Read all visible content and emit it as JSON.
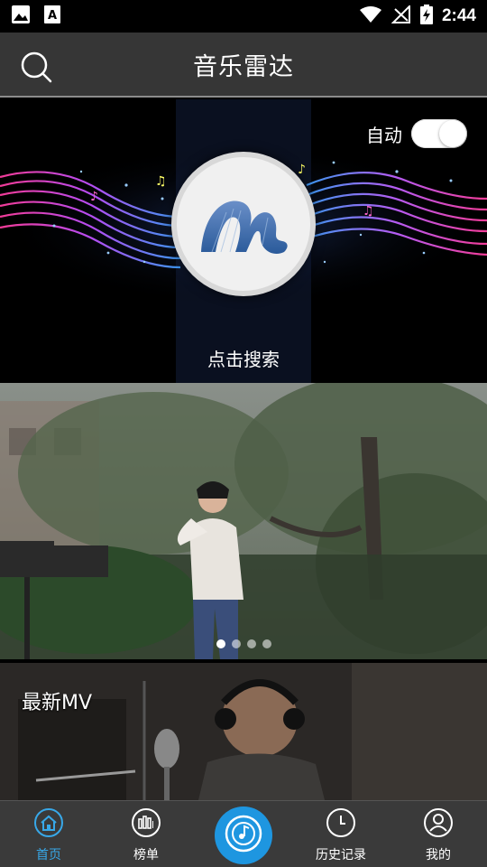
{
  "status_bar": {
    "time": "2:44",
    "left_icons": [
      "image-icon",
      "text-a-icon"
    ],
    "right_icons": [
      "wifi-icon",
      "no-signal-icon",
      "battery-charging-icon"
    ]
  },
  "header": {
    "title": "音乐雷达",
    "search_icon": "search-icon"
  },
  "radar": {
    "auto_label": "自动",
    "auto_enabled": true,
    "caption": "点击搜索",
    "button_icon": "radar-logo-icon"
  },
  "banner": {
    "slide_count": 4,
    "active_index": 0
  },
  "latest_mv": {
    "label": "最新MV"
  },
  "bottom_nav": {
    "items": [
      {
        "label": "首页",
        "icon": "home-icon",
        "active": true
      },
      {
        "label": "榜单",
        "icon": "chart-bars-icon",
        "active": false
      },
      {
        "label": "",
        "icon": "music-radar-icon",
        "active": false
      },
      {
        "label": "历史记录",
        "icon": "clock-icon",
        "active": false
      },
      {
        "label": "我的",
        "icon": "user-icon",
        "active": false
      }
    ]
  },
  "colors": {
    "accent": "#1e96e0",
    "active_nav": "#38a8e8",
    "header_bg": "#363636",
    "nav_bg": "#3a3a3a"
  }
}
